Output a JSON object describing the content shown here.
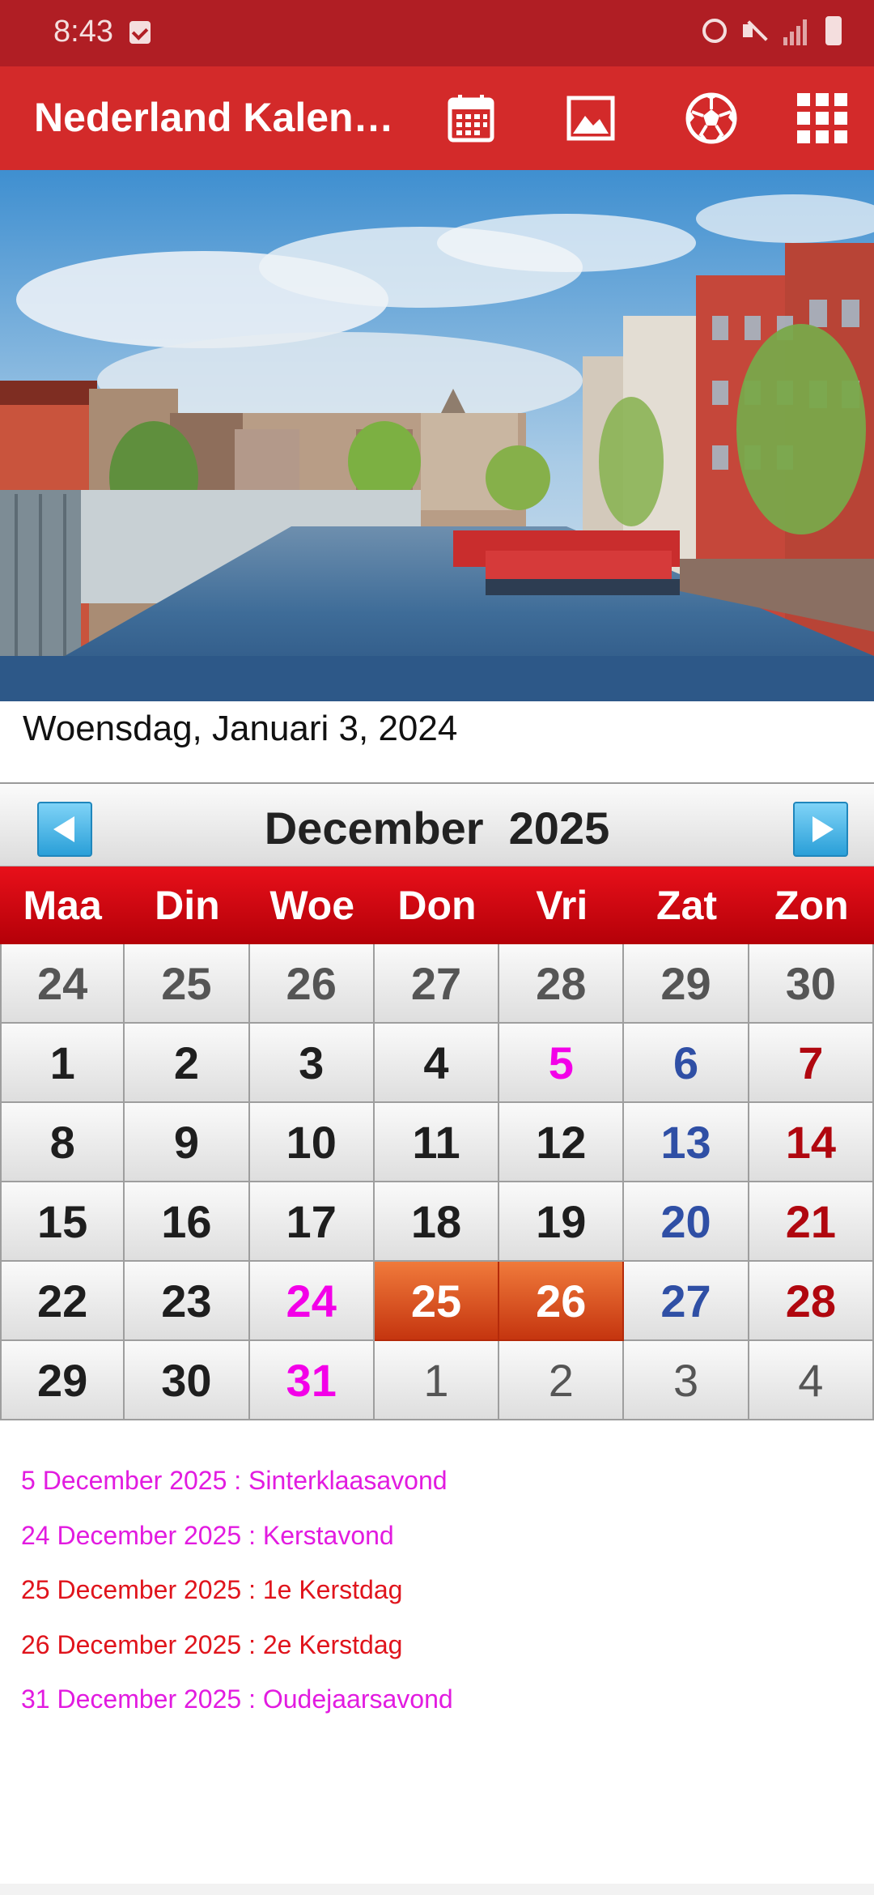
{
  "status_bar": {
    "time": "8:43",
    "icons": [
      "notification-check-icon",
      "alarm-icon",
      "mute-icon",
      "signal-icon",
      "battery-charging-icon"
    ]
  },
  "app_bar": {
    "title": "Nederland Kalen…",
    "actions": [
      "calendar-icon",
      "image-icon",
      "soccer-ball-icon",
      "grid-menu-icon"
    ]
  },
  "today_text": "Woensdag, Januari 3, 2024",
  "calendar": {
    "month_title": "December  2025",
    "weekdays": [
      "Maa",
      "Din",
      "Woe",
      "Don",
      "Vri",
      "Zat",
      "Zon"
    ],
    "weeks": [
      [
        "24",
        "25",
        "26",
        "27",
        "28",
        "29",
        "30"
      ],
      [
        "1",
        "2",
        "3",
        "4",
        "5",
        "6",
        "7"
      ],
      [
        "8",
        "9",
        "10",
        "11",
        "12",
        "13",
        "14"
      ],
      [
        "15",
        "16",
        "17",
        "18",
        "19",
        "20",
        "21"
      ],
      [
        "22",
        "23",
        "24",
        "25",
        "26",
        "27",
        "28"
      ],
      [
        "29",
        "30",
        "31",
        "1",
        "2",
        "3",
        "4"
      ]
    ]
  },
  "holidays": [
    {
      "text": "5 December 2025 : Sinterklaasavond",
      "color": "#e21be0"
    },
    {
      "text": "24 December 2025 : Kerstavond",
      "color": "#e21be0"
    },
    {
      "text": "25 December 2025 : 1e Kerstdag",
      "color": "#e0141c"
    },
    {
      "text": "26 December 2025 : 2e Kerstdag",
      "color": "#e0141c"
    },
    {
      "text": "31 December 2025 : Oudejaarsavond",
      "color": "#e21be0"
    }
  ],
  "colors": {
    "status_bar": "#b01e24",
    "app_bar": "#d32a2a",
    "weekday_header": "#e8101a",
    "highlight": "#f07a3b",
    "saturday": "#2f4fa5",
    "sunday": "#b0070f",
    "holiday_pink": "#f300e8"
  }
}
